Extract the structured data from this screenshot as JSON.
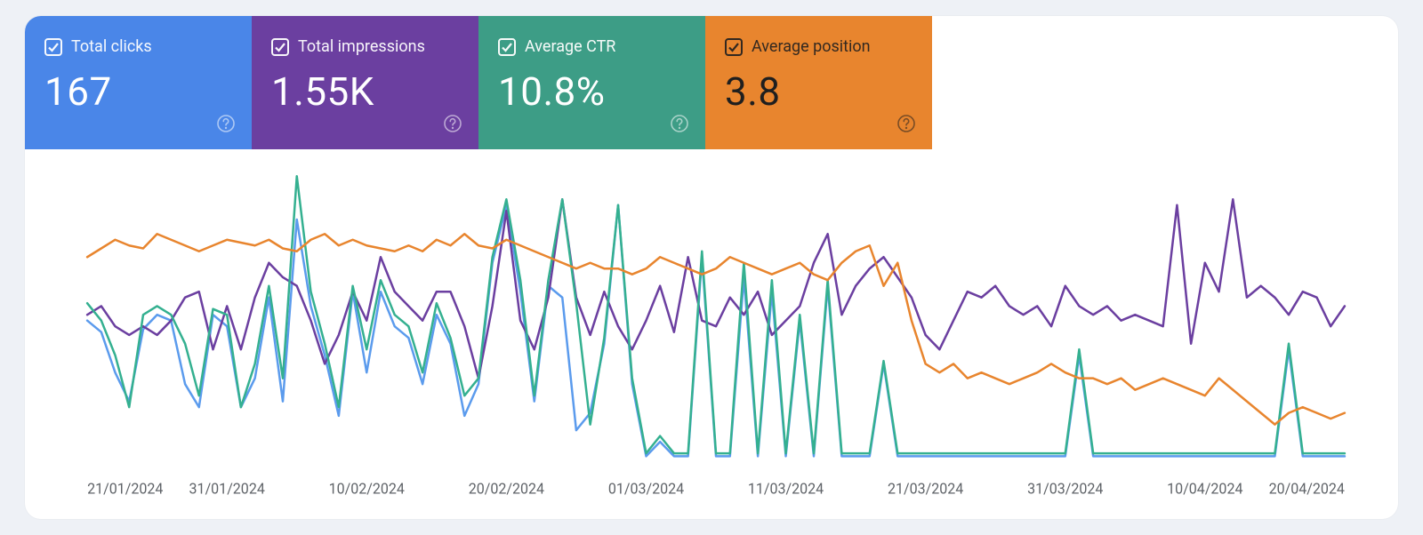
{
  "metrics": [
    {
      "id": "clicks",
      "label": "Total clicks",
      "value": "167",
      "color": "#4a86e8",
      "dark_text": false
    },
    {
      "id": "impressions",
      "label": "Total impressions",
      "value": "1.55K",
      "color": "#6b3fa0",
      "dark_text": false
    },
    {
      "id": "ctr",
      "label": "Average CTR",
      "value": "10.8%",
      "color": "#3d9d86",
      "dark_text": false
    },
    {
      "id": "position",
      "label": "Average position",
      "value": "3.8",
      "color": "#e8852e",
      "dark_text": true
    }
  ],
  "chart_data": {
    "type": "line",
    "xlabel": "",
    "ylabel": "",
    "x_ticks": [
      "21/01/2024",
      "31/01/2024",
      "10/02/2024",
      "20/02/2024",
      "01/03/2024",
      "11/03/2024",
      "21/03/2024",
      "31/03/2024",
      "10/04/2024",
      "20/04/2024"
    ],
    "ylim": [
      0,
      100
    ],
    "x_count": 91,
    "series": [
      {
        "name": "Total clicks",
        "color": "#5b9bed",
        "values": [
          50,
          46,
          32,
          22,
          47,
          52,
          50,
          28,
          20,
          52,
          48,
          20,
          30,
          58,
          22,
          85,
          55,
          38,
          17,
          60,
          32,
          60,
          48,
          44,
          28,
          52,
          42,
          17,
          28,
          70,
          90,
          60,
          22,
          62,
          58,
          12,
          18,
          42,
          90,
          28,
          3,
          8,
          3,
          3,
          72,
          3,
          3,
          65,
          3,
          60,
          3,
          50,
          3,
          62,
          3,
          3,
          3,
          35,
          3,
          3,
          3,
          3,
          3,
          3,
          3,
          3,
          3,
          3,
          3,
          3,
          3,
          38,
          3,
          3,
          3,
          3,
          3,
          3,
          3,
          3,
          3,
          3,
          3,
          3,
          3,
          3,
          40,
          3,
          3,
          3,
          3
        ]
      },
      {
        "name": "Total impressions",
        "color": "#6b3fa0",
        "values": [
          52,
          55,
          48,
          45,
          48,
          45,
          50,
          58,
          60,
          40,
          55,
          40,
          58,
          70,
          65,
          62,
          50,
          35,
          45,
          60,
          50,
          72,
          60,
          55,
          50,
          60,
          60,
          48,
          30,
          55,
          88,
          50,
          40,
          58,
          92,
          58,
          45,
          60,
          48,
          40,
          50,
          62,
          46,
          72,
          50,
          48,
          58,
          52,
          60,
          45,
          50,
          55,
          70,
          80,
          52,
          62,
          68,
          72,
          65,
          58,
          45,
          40,
          50,
          60,
          58,
          62,
          55,
          52,
          55,
          48,
          62,
          55,
          52,
          55,
          50,
          52,
          50,
          48,
          90,
          42,
          70,
          60,
          92,
          58,
          62,
          58,
          52,
          60,
          58,
          48,
          55
        ]
      },
      {
        "name": "Average CTR",
        "color": "#34b090",
        "values": [
          56,
          50,
          38,
          20,
          52,
          55,
          52,
          42,
          24,
          54,
          52,
          20,
          35,
          62,
          30,
          100,
          60,
          42,
          20,
          62,
          40,
          64,
          52,
          48,
          32,
          56,
          44,
          24,
          30,
          72,
          92,
          64,
          24,
          64,
          92,
          56,
          14,
          44,
          90,
          30,
          4,
          10,
          4,
          4,
          74,
          4,
          4,
          70,
          4,
          64,
          4,
          52,
          4,
          64,
          4,
          4,
          4,
          36,
          4,
          4,
          4,
          4,
          4,
          4,
          4,
          4,
          4,
          4,
          4,
          4,
          4,
          40,
          4,
          4,
          4,
          4,
          4,
          4,
          4,
          4,
          4,
          4,
          4,
          4,
          4,
          4,
          42,
          4,
          4,
          4,
          4
        ]
      },
      {
        "name": "Average position",
        "color": "#e8852e",
        "values": [
          72,
          75,
          78,
          76,
          75,
          80,
          78,
          76,
          74,
          76,
          78,
          77,
          76,
          78,
          75,
          74,
          78,
          80,
          76,
          78,
          76,
          75,
          74,
          76,
          74,
          78,
          76,
          80,
          76,
          75,
          78,
          76,
          74,
          72,
          70,
          68,
          70,
          68,
          68,
          66,
          68,
          72,
          70,
          68,
          66,
          68,
          72,
          70,
          68,
          66,
          68,
          70,
          66,
          64,
          70,
          74,
          76,
          62,
          70,
          50,
          35,
          32,
          35,
          30,
          32,
          30,
          28,
          30,
          32,
          35,
          32,
          30,
          30,
          28,
          30,
          26,
          28,
          30,
          28,
          26,
          24,
          30,
          26,
          22,
          18,
          14,
          18,
          20,
          18,
          16,
          18
        ]
      }
    ]
  }
}
